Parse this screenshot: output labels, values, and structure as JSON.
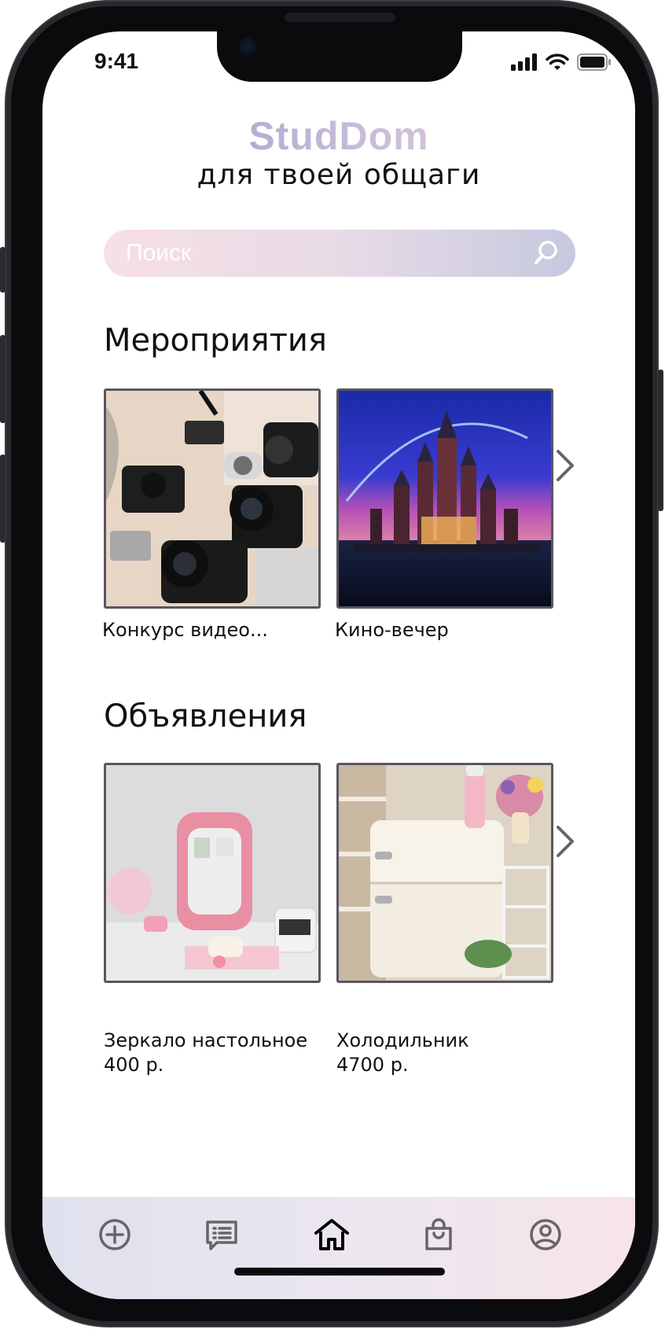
{
  "status_bar": {
    "time": "9:41"
  },
  "header": {
    "brand": "StudDom",
    "tagline": "для твоей общаги"
  },
  "search": {
    "placeholder": "Поиск"
  },
  "events": {
    "title": "Мероприятия",
    "items": [
      {
        "caption": "Конкурс видео..."
      },
      {
        "caption": "Кино-вечер"
      }
    ]
  },
  "listings": {
    "title": "Объявления",
    "items": [
      {
        "title": "Зеркало настольное",
        "price": "400 р."
      },
      {
        "title": "Холодильник",
        "price": "4700 р."
      }
    ]
  },
  "tab_bar": {
    "items": [
      {
        "icon": "add-circle-icon"
      },
      {
        "icon": "list-message-icon"
      },
      {
        "icon": "home-icon",
        "active": true
      },
      {
        "icon": "shopping-bag-icon"
      },
      {
        "icon": "profile-icon"
      }
    ]
  },
  "colors": {
    "accent_start": "#8e97c7",
    "accent_end": "#f6d1da",
    "card_border": "#5a5560"
  }
}
